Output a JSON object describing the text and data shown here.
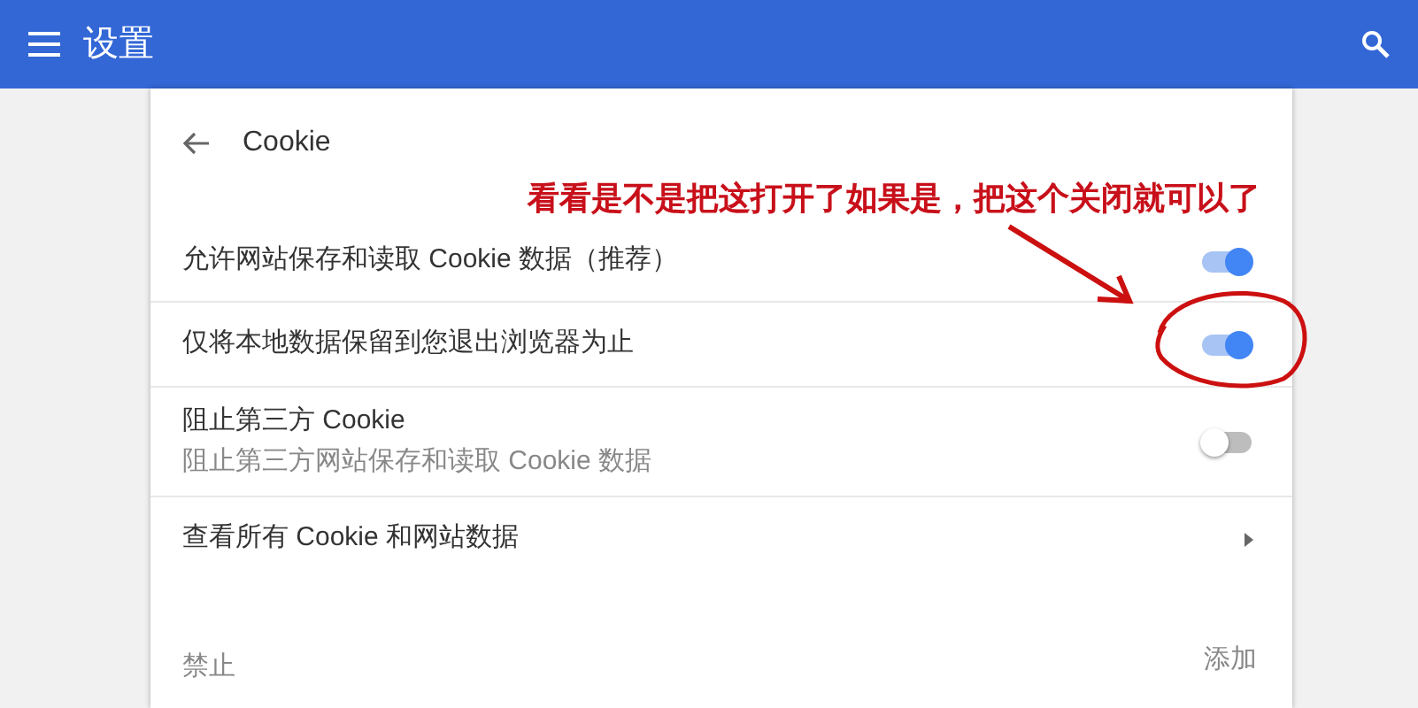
{
  "header": {
    "title": "设置"
  },
  "page": {
    "title": "Cookie"
  },
  "annotation": {
    "text": "看看是不是把这打开了如果是，把这个关闭就可以了"
  },
  "rows": [
    {
      "kind": "toggle",
      "label": "允许网站保存和读取 Cookie 数据（推荐）",
      "on": true
    },
    {
      "kind": "toggle",
      "label": "仅将本地数据保留到您退出浏览器为止",
      "on": true
    },
    {
      "kind": "toggle",
      "label": "阻止第三方 Cookie",
      "sublabel": "阻止第三方网站保存和读取 Cookie 数据",
      "on": false
    },
    {
      "kind": "link",
      "label": "查看所有 Cookie 和网站数据"
    }
  ],
  "blocked_section": {
    "title": "禁止",
    "add_button": "添加"
  }
}
